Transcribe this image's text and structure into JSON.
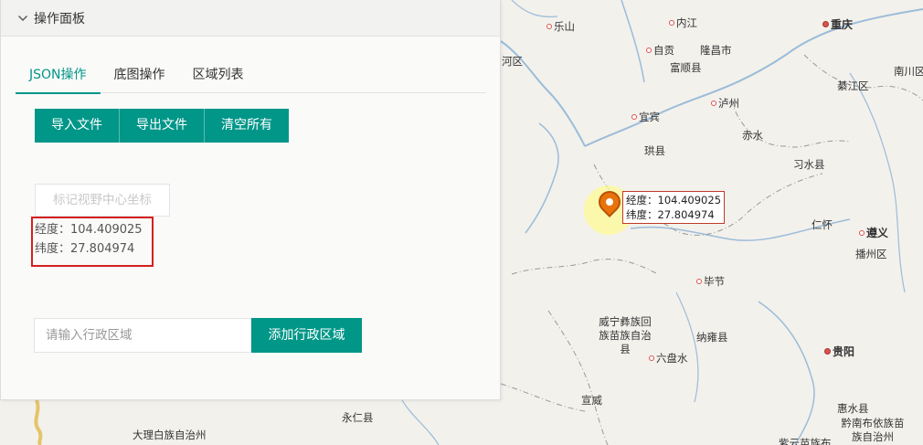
{
  "panel": {
    "title": "操作面板",
    "tabs": [
      {
        "label": "JSON操作",
        "active": true
      },
      {
        "label": "底图操作",
        "active": false
      },
      {
        "label": "区域列表",
        "active": false
      }
    ],
    "buttons": {
      "import": "导入文件",
      "export": "导出文件",
      "clear": "清空所有"
    },
    "mark_center_label": "标记视野中心坐标",
    "coords": {
      "lng": "经度：104.409025",
      "lat": "纬度：27.804974"
    },
    "region_input": {
      "placeholder": "请输入行政区域",
      "value": ""
    },
    "add_region_label": "添加行政区域"
  },
  "map": {
    "tooltip": {
      "lng": "经度：104.409025",
      "lat": "纬度：27.804974"
    },
    "cities": [
      "乐山",
      "内江",
      "重庆",
      "自贡",
      "隆昌市",
      "富顺县",
      "南川区",
      "河区",
      "綦江区",
      "泸州",
      "宜宾",
      "赤水",
      "珙县",
      "习水县",
      "仁怀",
      "遵义",
      "播州区",
      "毕节",
      "威宁彝族回族苗族自治县",
      "纳雍县",
      "六盘水",
      "贵阳",
      "宣威",
      "惠水县",
      "黔南布依族苗族自治州",
      "永仁县",
      "大理白族自治州",
      "紫云苗族布"
    ],
    "colors": {
      "accent": "#009688",
      "highlight_border": "#d61f1f",
      "marker": "#e8730c"
    }
  }
}
